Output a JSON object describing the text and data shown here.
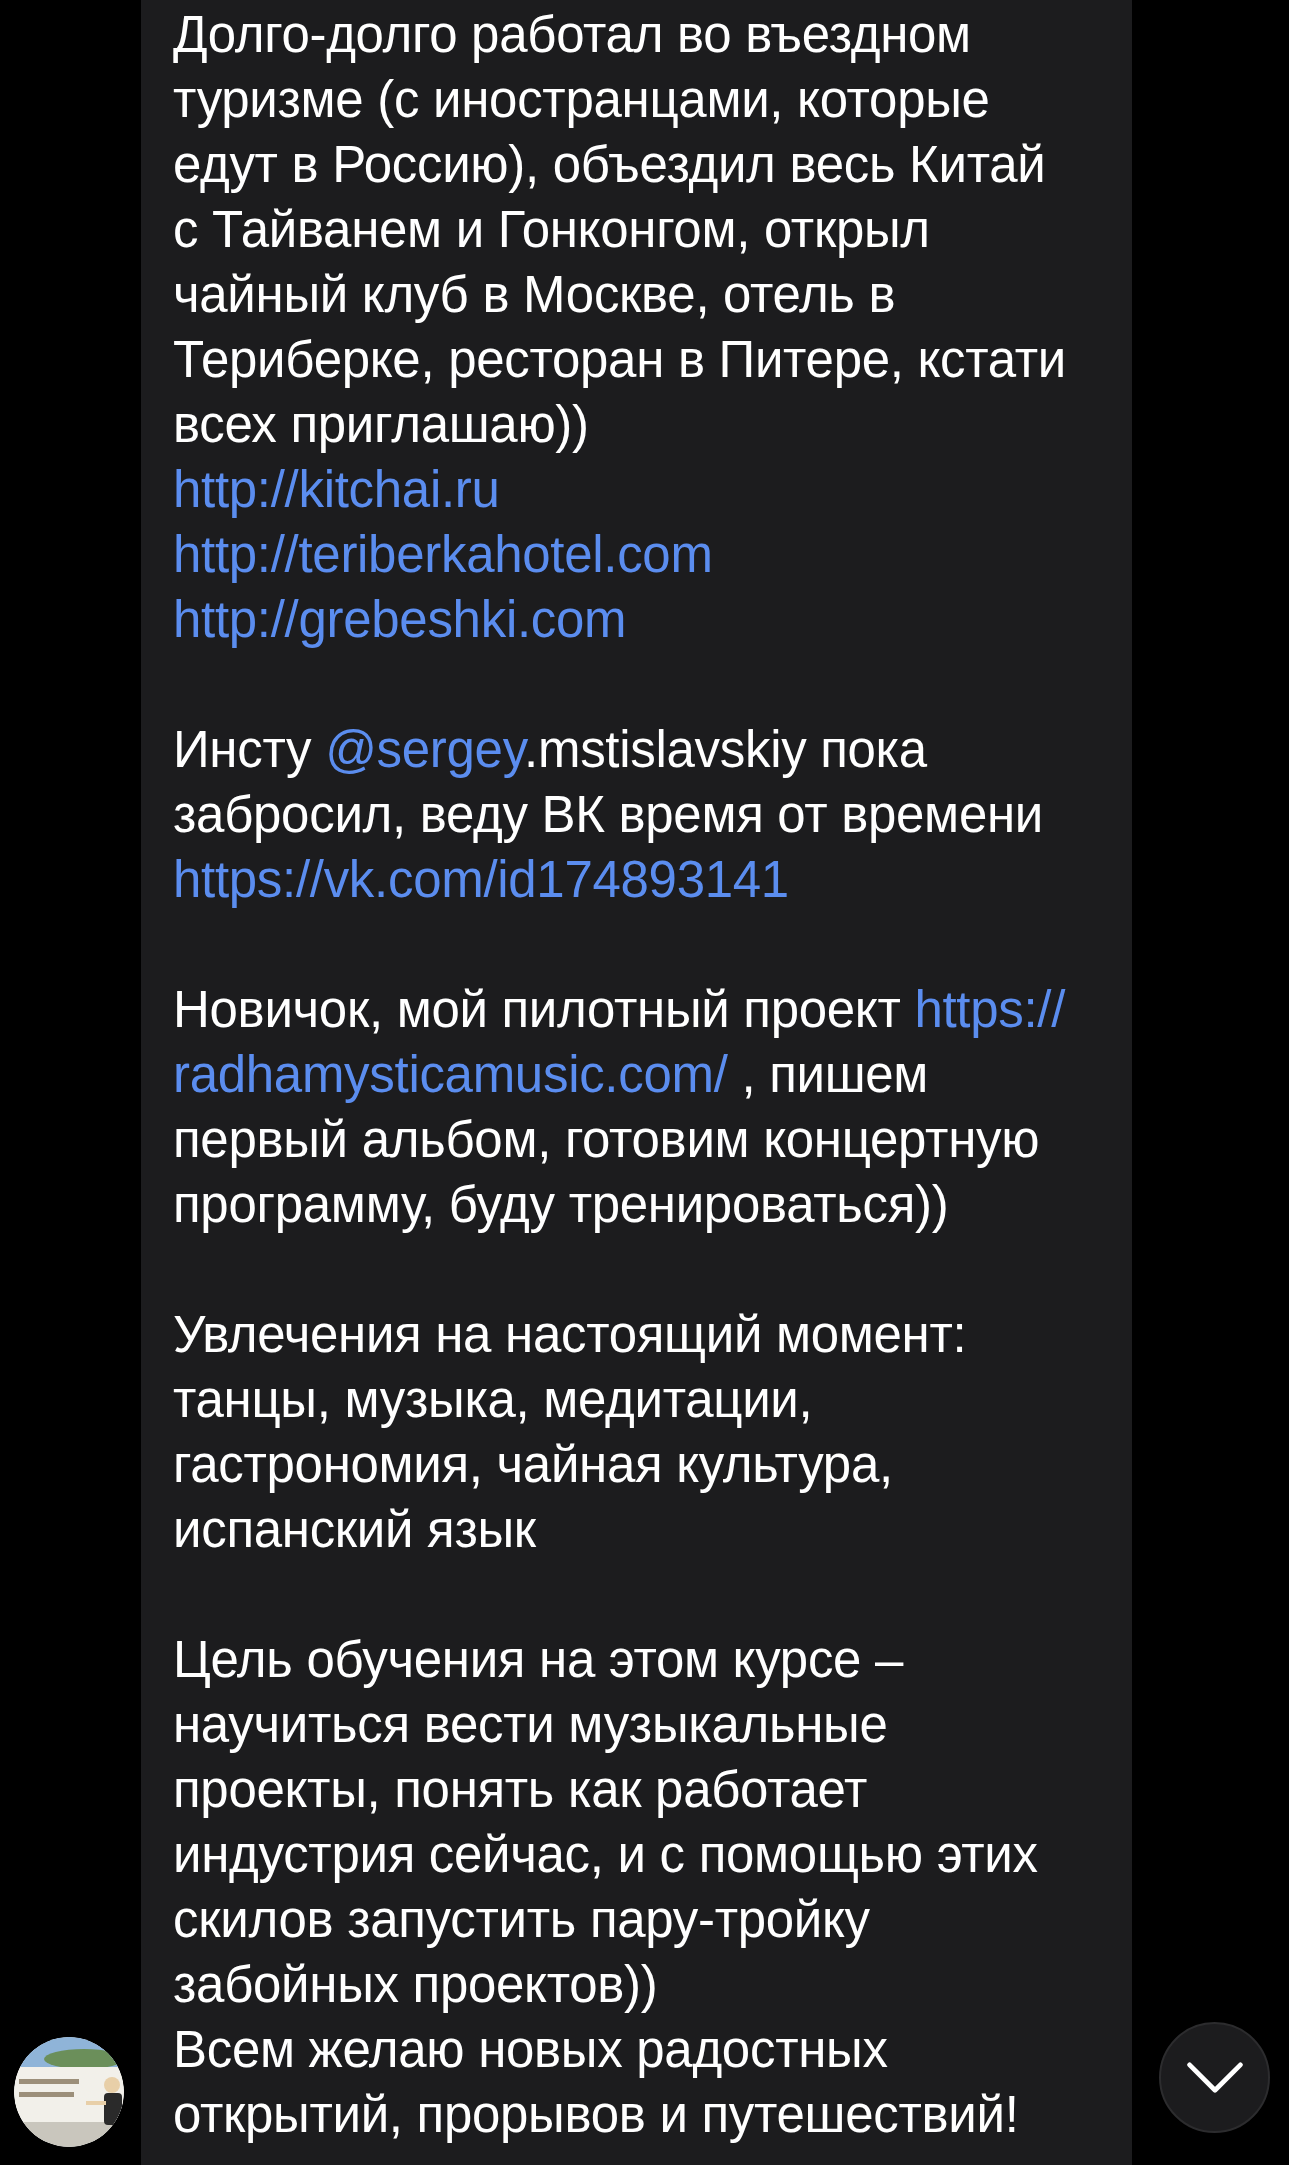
{
  "message": {
    "paragraphs": [
      {
        "segments": [
          {
            "kind": "text",
            "text": "Долго-долго работал во въездном\nтуризме (с иностранцами, которые\nедут в Россию), объездил весь Китай\nс Тайванем и Гонконгом, открыл\nчайный клуб в Москве, отель в\nТериберке, ресторан в Питере, кстати\nвсех приглашаю))"
          },
          {
            "kind": "break"
          },
          {
            "kind": "link",
            "text": "http://kitchai.ru"
          },
          {
            "kind": "break"
          },
          {
            "kind": "link",
            "text": "http://teriberkahotel.com"
          },
          {
            "kind": "break"
          },
          {
            "kind": "link",
            "text": "http://grebeshki.com"
          }
        ]
      },
      {
        "segments": [
          {
            "kind": "text",
            "text": "Инсту "
          },
          {
            "kind": "link",
            "text": "@sergey"
          },
          {
            "kind": "text",
            "text": ".mstislavskiy пока\nзабросил, веду ВК время от времени"
          },
          {
            "kind": "break"
          },
          {
            "kind": "link",
            "text": "https://vk.com/id174893141"
          }
        ]
      },
      {
        "segments": [
          {
            "kind": "text",
            "text": "Новичок, мой пилотный проект "
          },
          {
            "kind": "link",
            "text": "https://"
          },
          {
            "kind": "break"
          },
          {
            "kind": "link",
            "text": "radhamysticamusic.com/"
          },
          {
            "kind": "text",
            "text": " , пишем\nпервый альбом, готовим концертную\nпрограмму, буду тренироваться))"
          }
        ]
      },
      {
        "segments": [
          {
            "kind": "text",
            "text": "Увлечения на настоящий момент:\nтанцы, музыка, медитации,\nгастрономия, чайная культура,\nиспанский язык"
          }
        ]
      },
      {
        "segments": [
          {
            "kind": "text",
            "text": "Цель обучения на этом курсе –\nнаучиться вести музыкальные\nпроекты, понять как работает\nиндустрия сейчас, и с помощью этих\nскилов запустить пару-тройку\nзабойных проектов))\nВсем желаю новых радостных\nоткрытий, прорывов и путешествий!"
          }
        ]
      }
    ]
  },
  "scroll_down_button": {
    "kind": "chevron"
  }
}
